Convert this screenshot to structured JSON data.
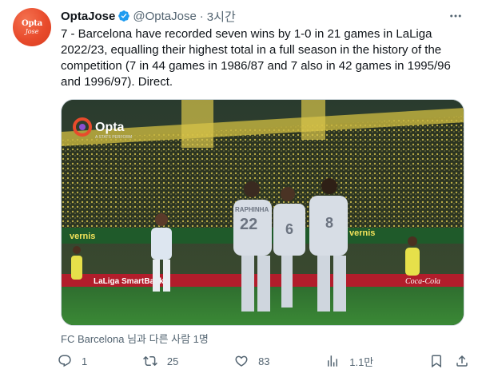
{
  "author": {
    "display_name": "OptaJose",
    "handle": "@OptaJose",
    "separator": "·",
    "time": "3시간",
    "avatar_text_1": "Opta",
    "avatar_text_2": "Jose"
  },
  "tweet": {
    "text": "7 - Barcelona have recorded seven wins by 1-0 in 21 games in LaLiga 2022/23, equalling their highest total in a full season in the history of the competition (7 in 44 games in 1986/87 and 7 also in 42 games in 1995/96 and 1996/97). Direct."
  },
  "media": {
    "opta_logo": "Opta",
    "opta_sub": "A STATS PERFORM",
    "ad_text_1": "vernis",
    "ad_text_2": "LaLiga",
    "ad_text_3": "Coca-Cola",
    "ad_text_4": "LaLiga SmartBank",
    "player_number_1": "22",
    "player_number_2": "6",
    "player_number_3": "8",
    "player_name_1": "RAPHINHA"
  },
  "tagged": "FC Barcelona 님과 다른 사람 1명",
  "actions": {
    "reply_count": "1",
    "retweet_count": "25",
    "like_count": "83",
    "view_count": "1.1만"
  },
  "colors": {
    "accent": "#1d9bf0",
    "muted": "#536471",
    "avatar": "#e84b2c"
  }
}
